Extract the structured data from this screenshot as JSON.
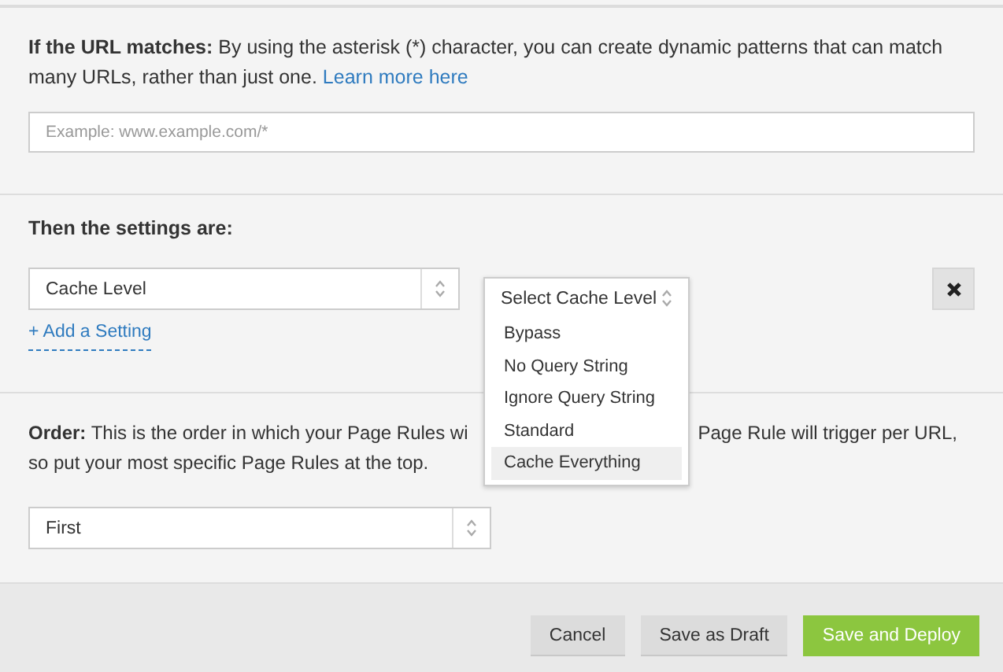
{
  "url_section": {
    "label": "If the URL matches:",
    "text": "By using the asterisk (*) character, you can create dynamic patterns that can match many URLs, rather than just one.",
    "link": "Learn more here",
    "placeholder": "Example: www.example.com/*"
  },
  "settings_section": {
    "heading": "Then the settings are:",
    "setting": "Cache Level",
    "add_link": "+ Add a Setting",
    "value_select": {
      "label": "Select Cache Level",
      "expanded": true,
      "options": [
        {
          "label": "Bypass",
          "selected": false
        },
        {
          "label": "No Query String",
          "selected": false
        },
        {
          "label": "Ignore Query String",
          "selected": false
        },
        {
          "label": "Standard",
          "selected": false
        },
        {
          "label": "Cache Everything",
          "selected": true
        }
      ]
    }
  },
  "order_section": {
    "label": "Order:",
    "text_visible_left": "This is the order in which your Page Rules wi",
    "text_visible_right": "Page Rule will trigger per URL,",
    "text_line_2": "so put your most specific Page Rules at the top.",
    "value": "First"
  },
  "buttons": [
    {
      "label": "Cancel",
      "kind": "secondary"
    },
    {
      "label": "Save as Draft",
      "kind": "secondary"
    },
    {
      "label": "Save and Deploy",
      "kind": "primary"
    }
  ]
}
